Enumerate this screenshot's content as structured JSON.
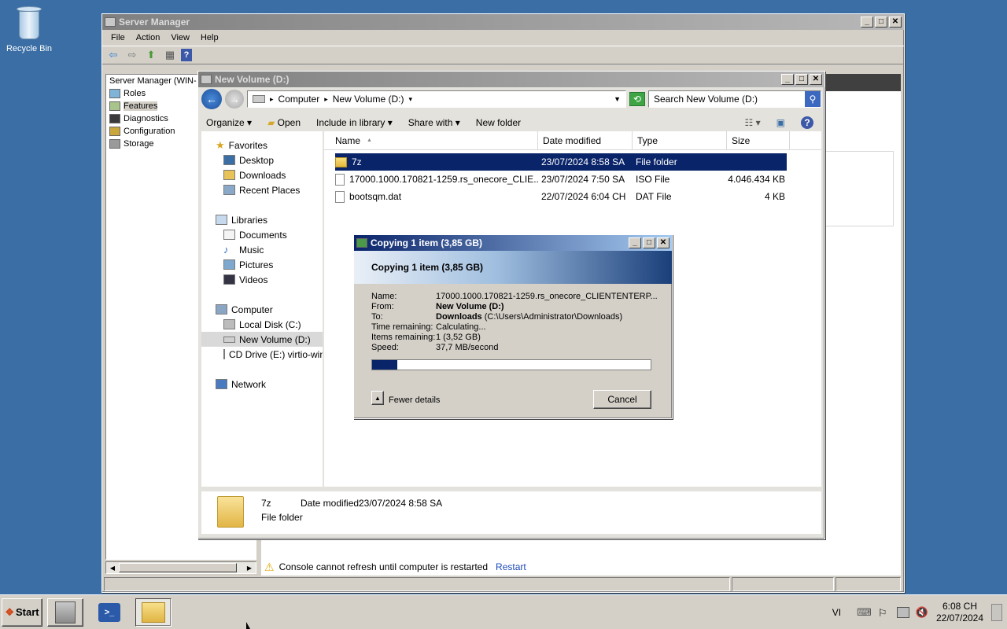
{
  "desktop": {
    "recycle_bin_label": "Recycle Bin"
  },
  "server_manager": {
    "title": "Server Manager",
    "menu": [
      "File",
      "Action",
      "View",
      "Help"
    ],
    "tree": [
      {
        "label": "Server Manager (WIN-",
        "icon": "server-icon"
      },
      {
        "label": "Roles",
        "icon": "roles-icon"
      },
      {
        "label": "Features",
        "icon": "features-icon"
      },
      {
        "label": "Diagnostics",
        "icon": "diagnostics-icon"
      },
      {
        "label": "Configuration",
        "icon": "configuration-icon"
      },
      {
        "label": "Storage",
        "icon": "storage-icon"
      }
    ],
    "status_message": "Console cannot refresh until computer is restarted",
    "status_link": "Restart"
  },
  "explorer": {
    "title": "New Volume (D:)",
    "address": [
      "Computer",
      "New Volume (D:)"
    ],
    "search_placeholder": "Search New Volume (D:)",
    "commands": [
      "Organize",
      "Open",
      "Include in library",
      "Share with",
      "New folder"
    ],
    "nav": {
      "favorites_label": "Favorites",
      "favorites": [
        "Desktop",
        "Downloads",
        "Recent Places"
      ],
      "libraries_label": "Libraries",
      "libraries": [
        "Documents",
        "Music",
        "Pictures",
        "Videos"
      ],
      "computer_label": "Computer",
      "computer": [
        "Local Disk (C:)",
        "New Volume (D:)",
        "CD Drive (E:) virtio-win"
      ],
      "network_label": "Network"
    },
    "columns": {
      "name": "Name",
      "date": "Date modified",
      "type": "Type",
      "size": "Size"
    },
    "files": [
      {
        "name": "7z",
        "date": "23/07/2024 8:58 SA",
        "type": "File folder",
        "size": ""
      },
      {
        "name": "17000.1000.170821-1259.rs_onecore_CLIE...",
        "date": "23/07/2024 7:50 SA",
        "type": "ISO File",
        "size": "4.046.434 KB"
      },
      {
        "name": "bootsqm.dat",
        "date": "22/07/2024 6:04 CH",
        "type": "DAT File",
        "size": "4 KB"
      }
    ],
    "details": {
      "name": "7z",
      "date_label": "Date modified:",
      "date_value": "23/07/2024 8:58 SA",
      "type": "File folder"
    }
  },
  "copy_dialog": {
    "title": "Copying 1 item (3,85 GB)",
    "heading": "Copying 1 item (3,85 GB)",
    "name_label": "Name:",
    "name_value": "17000.1000.170821-1259.rs_onecore_CLIENTENTERP...",
    "from_label": "From:",
    "from_value": "New Volume (D:)",
    "to_label": "To:",
    "to_bold": "Downloads",
    "to_path": "(C:\\Users\\Administrator\\Downloads)",
    "time_label": "Time remaining:",
    "time_value": "Calculating...",
    "items_label": "Items remaining:",
    "items_value": "1 (3,52 GB)",
    "speed_label": "Speed:",
    "speed_value": "37,7 MB/second",
    "progress_fraction": 0.09,
    "fewer_details": "Fewer details",
    "cancel": "Cancel"
  },
  "taskbar": {
    "start_label": "Start",
    "language": "VI",
    "time": "6:08 CH",
    "date": "22/07/2024"
  }
}
